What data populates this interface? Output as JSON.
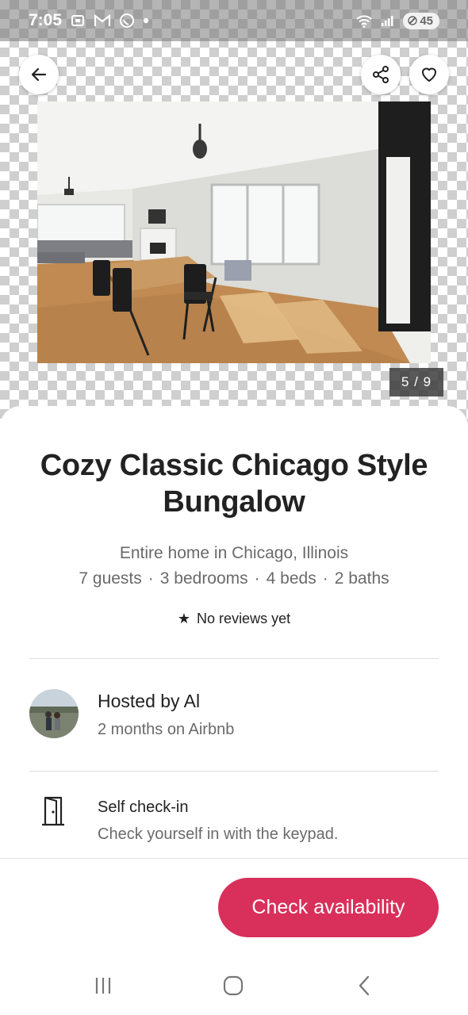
{
  "status_bar": {
    "time": "7:05",
    "battery": "45",
    "icons": [
      "screenshot-icon",
      "gmail-icon",
      "whatsapp-icon",
      "dot-icon",
      "wifi-icon",
      "signal-icon",
      "battery-icon"
    ]
  },
  "photo": {
    "counter": "5 / 9"
  },
  "listing": {
    "title": "Cozy Classic Chicago Style Bungalow",
    "subtitle": "Entire home in Chicago, Illinois",
    "facts": [
      "7 guests",
      "3 bedrooms",
      "4 beds",
      "2 baths"
    ],
    "fact_separator": "·",
    "rating_text": "No reviews yet",
    "rating_icon": "★"
  },
  "host": {
    "name": "Hosted by Al",
    "meta": "2 months on Airbnb"
  },
  "highlights": {
    "checkin_title": "Self check-in",
    "checkin_desc": "Check yourself in with the keypad."
  },
  "footer": {
    "cta_label": "Check availability"
  },
  "colors": {
    "accent": "#d8305b",
    "text_primary": "#222222",
    "text_secondary": "#6a6a6a"
  }
}
